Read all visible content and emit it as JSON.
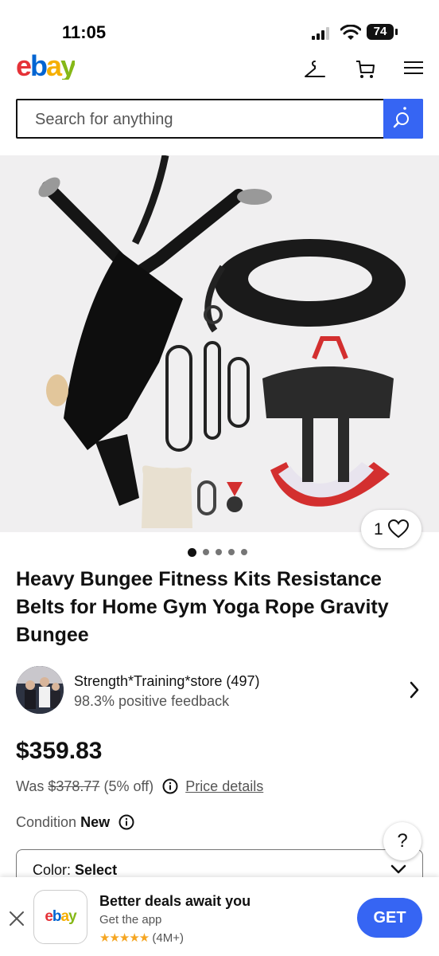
{
  "status_bar": {
    "time": "11:05",
    "battery": "74"
  },
  "header": {
    "logo": {
      "e": "e",
      "b": "b",
      "a": "a",
      "y": "y"
    },
    "icons": [
      "hanger-icon",
      "cart-icon",
      "menu-icon"
    ]
  },
  "search": {
    "placeholder": "Search for anything"
  },
  "gallery": {
    "watch_count": "1",
    "image_count": 5,
    "active_image": 1
  },
  "product": {
    "title": "Heavy Bungee Fitness Kits Resistance Belts for Home Gym Yoga Rope Gravity Bungee"
  },
  "seller": {
    "name": "Strength*Training*store (497)",
    "feedback": "98.3% positive feedback"
  },
  "pricing": {
    "price": "$359.83",
    "was_label": "Was",
    "was_price": "$378.77",
    "discount": "(5% off)",
    "details_link": "Price details"
  },
  "condition": {
    "label": "Condition",
    "value": "New"
  },
  "help": {
    "label": "?"
  },
  "variation": {
    "label": "Color:",
    "value": "Select"
  },
  "app_banner": {
    "title": "Better deals await you",
    "subtitle": "Get the app",
    "stars": "★★★★★",
    "rating_count": "(4M+)",
    "cta": "GET",
    "app_icon_text": {
      "e": "e",
      "b": "b",
      "a": "a",
      "y": "y"
    }
  },
  "colors": {
    "accent": "#3665f3",
    "text": "#111111",
    "secondary": "#555555",
    "star": "#f5a623"
  }
}
